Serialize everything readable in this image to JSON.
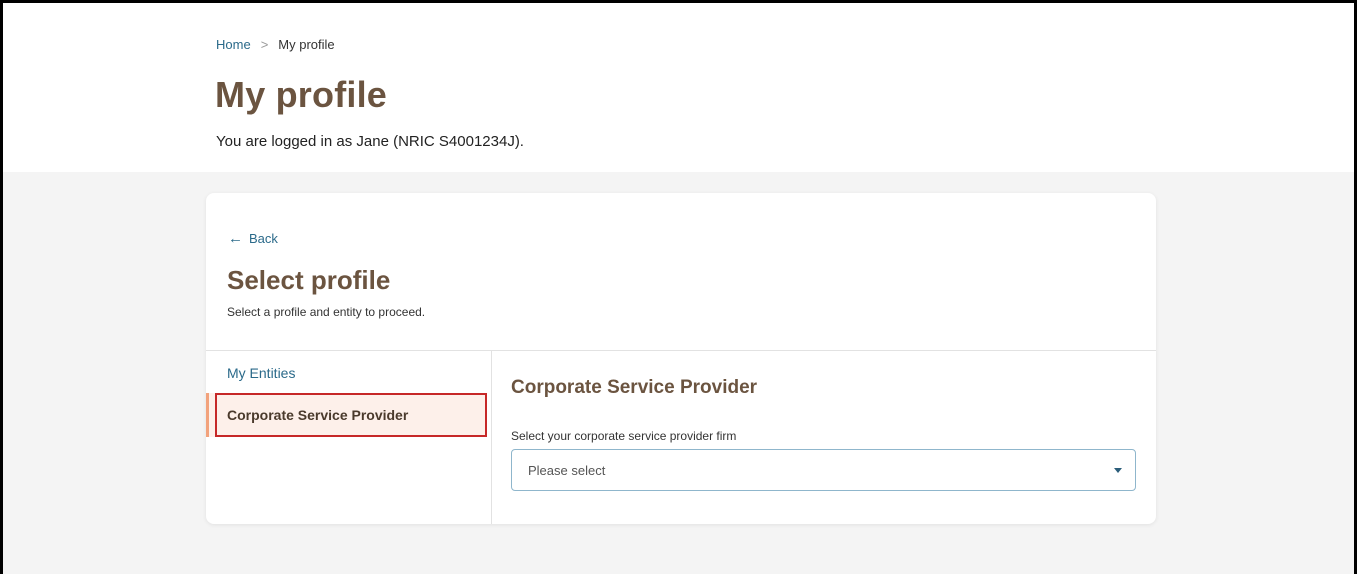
{
  "breadcrumb": {
    "home": "Home",
    "separator": ">",
    "current": "My profile"
  },
  "page": {
    "title": "My profile",
    "logged_in_text": "You are logged in as Jane (NRIC S4001234J)."
  },
  "card": {
    "back_label": "Back",
    "back_icon": "arrow-left-icon",
    "title": "Select profile",
    "subtitle": "Select a profile and entity to proceed."
  },
  "sidebar": {
    "heading": "My Entities",
    "items": [
      {
        "label": "Corporate Service Provider",
        "selected": true
      }
    ]
  },
  "content": {
    "title": "Corporate Service Provider",
    "field_label": "Select your corporate service provider firm",
    "select_placeholder": "Please select",
    "select_icon": "chevron-down-icon"
  },
  "colors": {
    "heading_brown": "#6b5440",
    "link_blue": "#2b6a8a",
    "selected_bg": "#fdf0ea",
    "selected_accent": "#f2a27c",
    "highlight_red": "#c62828",
    "page_gray": "#f4f4f4"
  }
}
